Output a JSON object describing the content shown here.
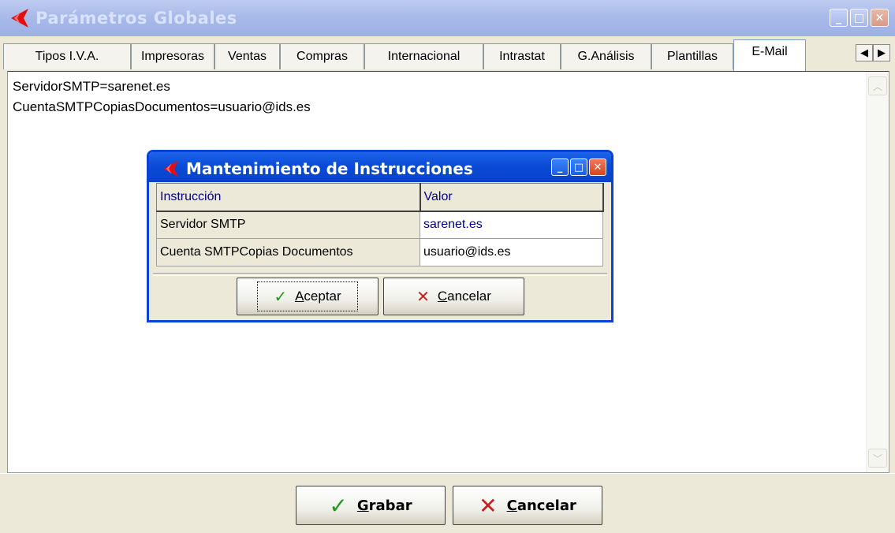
{
  "window": {
    "title": "Parámetros Globales",
    "controls": {
      "minimize": "_",
      "maximize": "□",
      "close": "✕"
    }
  },
  "tabs": [
    {
      "label": "Tipos I.V.A."
    },
    {
      "label": "Impresoras"
    },
    {
      "label": "Ventas"
    },
    {
      "label": "Compras"
    },
    {
      "label": "Internacional"
    },
    {
      "label": "Intrastat"
    },
    {
      "label": "G.Análisis"
    },
    {
      "label": "Plantillas"
    },
    {
      "label": "E-Mail"
    }
  ],
  "active_tab": "E-Mail",
  "tab_scroll": {
    "left": "◀",
    "right": "▶"
  },
  "memo": {
    "lines": [
      "ServidorSMTP=sarenet.es",
      "CuentaSMTPCopiasDocumentos=usuario@ids.es"
    ],
    "scroll_up": "︿",
    "scroll_down": "﹀"
  },
  "dialog": {
    "title": "Mantenimiento de Instrucciones",
    "controls": {
      "minimize": "_",
      "maximize": "□",
      "close": "✕"
    },
    "columns": [
      "Instrucción",
      "Valor"
    ],
    "rows": [
      {
        "instruccion": "Servidor SMTP",
        "valor": "sarenet.es"
      },
      {
        "instruccion": "Cuenta SMTPCopias Documentos",
        "valor": "usuario@ids.es"
      }
    ],
    "accept": {
      "glyph": "✓",
      "mnemonic": "A",
      "rest": "ceptar"
    },
    "cancel": {
      "glyph": "✕",
      "mnemonic": "C",
      "rest": "ancelar"
    }
  },
  "footer": {
    "save": {
      "glyph": "✓",
      "mnemonic": "G",
      "rest": "rabar"
    },
    "cancel": {
      "glyph": "✕",
      "mnemonic": "C",
      "rest": "ancelar"
    }
  },
  "colors": {
    "check_green": "#1E9B1E",
    "cross_red": "#C81E1E",
    "dialog_blue": "#0842D8",
    "value_blue": "#00008B"
  }
}
